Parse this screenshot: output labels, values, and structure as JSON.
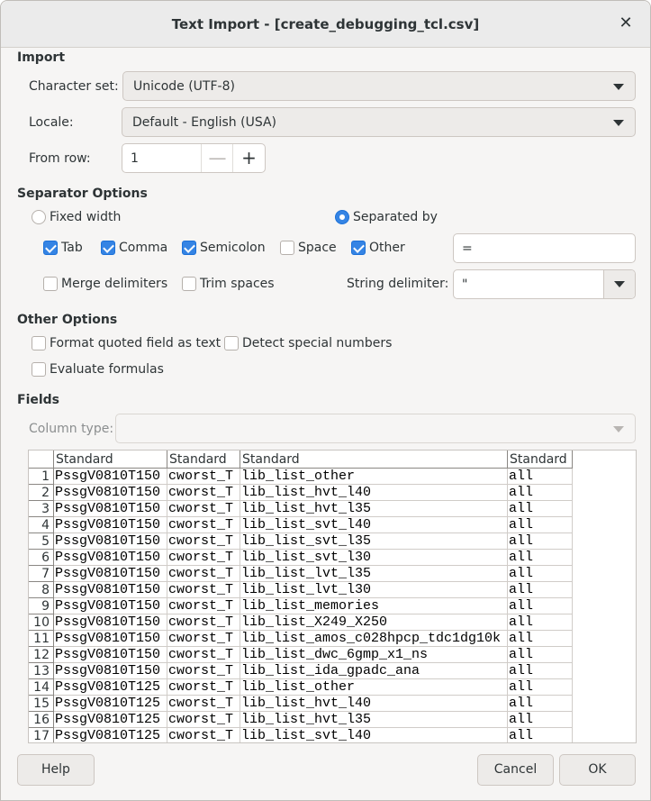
{
  "window": {
    "title": "Text Import - [create_debugging_tcl.csv]"
  },
  "import": {
    "heading": "Import",
    "charset_label": "Character set:",
    "charset_value": "Unicode (UTF-8)",
    "locale_label": "Locale:",
    "locale_value": "Default - English (USA)",
    "from_row_label": "From row:",
    "from_row_value": "1"
  },
  "separator": {
    "heading": "Separator Options",
    "fixed_width": {
      "label": "Fixed width",
      "selected": false
    },
    "separated_by": {
      "label": "Separated by",
      "selected": true
    },
    "tab": {
      "label": "Tab",
      "checked": true
    },
    "comma": {
      "label": "Comma",
      "checked": true
    },
    "semicolon": {
      "label": "Semicolon",
      "checked": true
    },
    "space": {
      "label": "Space",
      "checked": false
    },
    "other": {
      "label": "Other",
      "checked": true
    },
    "other_value": "=",
    "merge": {
      "label": "Merge delimiters",
      "checked": false
    },
    "trim": {
      "label": "Trim spaces",
      "checked": false
    },
    "string_delim_label": "String delimiter:",
    "string_delim_value": "\""
  },
  "other_options": {
    "heading": "Other Options",
    "format_quoted": {
      "label": "Format quoted field as text",
      "checked": false
    },
    "detect_special": {
      "label": "Detect special numbers",
      "checked": false
    },
    "evaluate": {
      "label": "Evaluate formulas",
      "checked": false
    }
  },
  "fields": {
    "heading": "Fields",
    "column_type_label": "Column type:",
    "column_type_value": "",
    "headers": [
      "Standard",
      "Standard",
      "Standard",
      "Standard"
    ],
    "rows": [
      [
        "1",
        "PssgV0810T150",
        "cworst_T",
        "lib_list_other",
        "all"
      ],
      [
        "2",
        "PssgV0810T150",
        "cworst_T",
        "lib_list_hvt_l40",
        "all"
      ],
      [
        "3",
        "PssgV0810T150",
        "cworst_T",
        "lib_list_hvt_l35",
        "all"
      ],
      [
        "4",
        "PssgV0810T150",
        "cworst_T",
        "lib_list_svt_l40",
        "all"
      ],
      [
        "5",
        "PssgV0810T150",
        "cworst_T",
        "lib_list_svt_l35",
        "all"
      ],
      [
        "6",
        "PssgV0810T150",
        "cworst_T",
        "lib_list_svt_l30",
        "all"
      ],
      [
        "7",
        "PssgV0810T150",
        "cworst_T",
        "lib_list_lvt_l35",
        "all"
      ],
      [
        "8",
        "PssgV0810T150",
        "cworst_T",
        "lib_list_lvt_l30",
        "all"
      ],
      [
        "9",
        "PssgV0810T150",
        "cworst_T",
        "lib_list_memories",
        "all"
      ],
      [
        "10",
        "PssgV0810T150",
        "cworst_T",
        "lib_list_X249_X250",
        "all"
      ],
      [
        "11",
        "PssgV0810T150",
        "cworst_T",
        "lib_list_amos_c028hpcp_tdc1dg10k",
        "all"
      ],
      [
        "12",
        "PssgV0810T150",
        "cworst_T",
        "lib_list_dwc_6gmp_x1_ns",
        "all"
      ],
      [
        "13",
        "PssgV0810T150",
        "cworst_T",
        "lib_list_ida_gpadc_ana",
        "all"
      ],
      [
        "14",
        "PssgV0810T125",
        "cworst_T",
        "lib_list_other",
        "all"
      ],
      [
        "15",
        "PssgV0810T125",
        "cworst_T",
        "lib_list_hvt_l40",
        "all"
      ],
      [
        "16",
        "PssgV0810T125",
        "cworst_T",
        "lib_list_hvt_l35",
        "all"
      ],
      [
        "17",
        "PssgV0810T125",
        "cworst_T",
        "lib_list_svt_l40",
        "all"
      ]
    ]
  },
  "buttons": {
    "help": "Help",
    "cancel": "Cancel",
    "ok": "OK"
  }
}
